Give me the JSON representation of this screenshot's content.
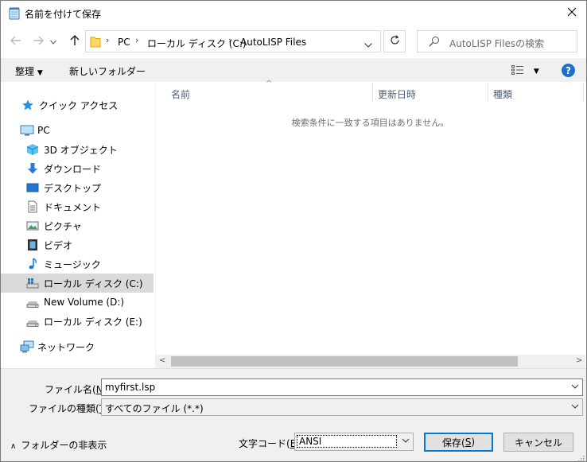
{
  "window": {
    "title": "名前を付けて保存"
  },
  "address": {
    "breadcrumb": [
      "PC",
      "ローカル ディスク (C:)",
      "AutoLISP Files"
    ],
    "search_placeholder": "AutoLISP Filesの検索"
  },
  "toolbar": {
    "organize_label": "整理",
    "new_folder_label": "新しいフォルダー"
  },
  "nav": {
    "quick_access": "クイック アクセス",
    "pc": "PC",
    "items": [
      "3D オブジェクト",
      "ダウンロード",
      "デスクトップ",
      "ドキュメント",
      "ピクチャ",
      "ビデオ",
      "ミュージック",
      "ローカル ディスク (C:)",
      "New Volume (D:)",
      "ローカル ディスク (E:)"
    ],
    "network": "ネットワーク",
    "selected_item": "ローカル ディスク (C:)"
  },
  "filelist": {
    "columns": [
      "名前",
      "更新日時",
      "種類"
    ],
    "empty_message": "検索条件に一致する項目はありません。"
  },
  "form": {
    "filename_label_pre": "ファイル名(",
    "filename_label_key": "N",
    "filename_label_post": "):",
    "filename_value": "myfirst.lsp",
    "filetype_label_pre": "ファイルの種類(",
    "filetype_label_key": "T",
    "filetype_label_post": "):",
    "filetype_value": "すべてのファイル (*.*)",
    "encoding_label_pre": "文字コード(",
    "encoding_label_key": "E",
    "encoding_label_post": "):",
    "encoding_value": "ANSI",
    "hide_folders_label": "フォルダーの非表示",
    "save_label_pre": "保存(",
    "save_label_key": "S",
    "save_label_post": ")",
    "cancel_label": "キャンセル"
  },
  "colors": {
    "accent": "#0078d7",
    "selected_bg": "#d9d9d9",
    "help": "#1e6fc8"
  }
}
